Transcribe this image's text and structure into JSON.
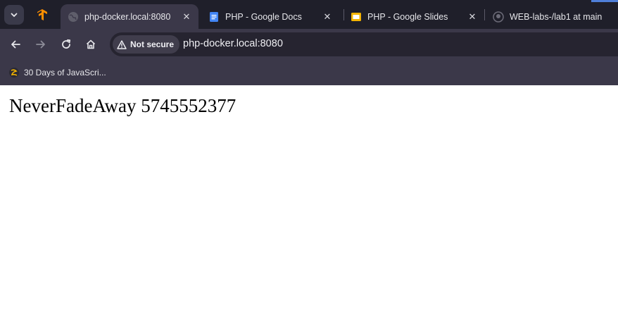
{
  "tabs": [
    {
      "title": "php-docker.local:8080",
      "icon": "globe-icon",
      "active": true
    },
    {
      "title": "PHP - Google Docs",
      "icon": "google-docs-icon",
      "active": false
    },
    {
      "title": "PHP - Google Slides",
      "icon": "google-slides-icon",
      "active": false
    },
    {
      "title": "WEB-labs-/lab1 at main",
      "icon": "github-icon",
      "active": false
    }
  ],
  "pinned_tab": {
    "icon": "tensorflow-icon"
  },
  "toolbar": {
    "security_label": "Not secure",
    "url": "php-docker.local:8080"
  },
  "bookmarks": [
    {
      "label": "30 Days of JavaScri...",
      "icon": "javascript-bookmark-icon"
    }
  ],
  "page": {
    "text": "NeverFadeAway 5745552377"
  },
  "colors": {
    "tabstrip": "#1f1f2a",
    "toolbar": "#3b3849",
    "omnibox": "#262430",
    "docs_blue": "#4285f4",
    "slides_yellow": "#f4b400",
    "accent": "#4f7fd9"
  }
}
